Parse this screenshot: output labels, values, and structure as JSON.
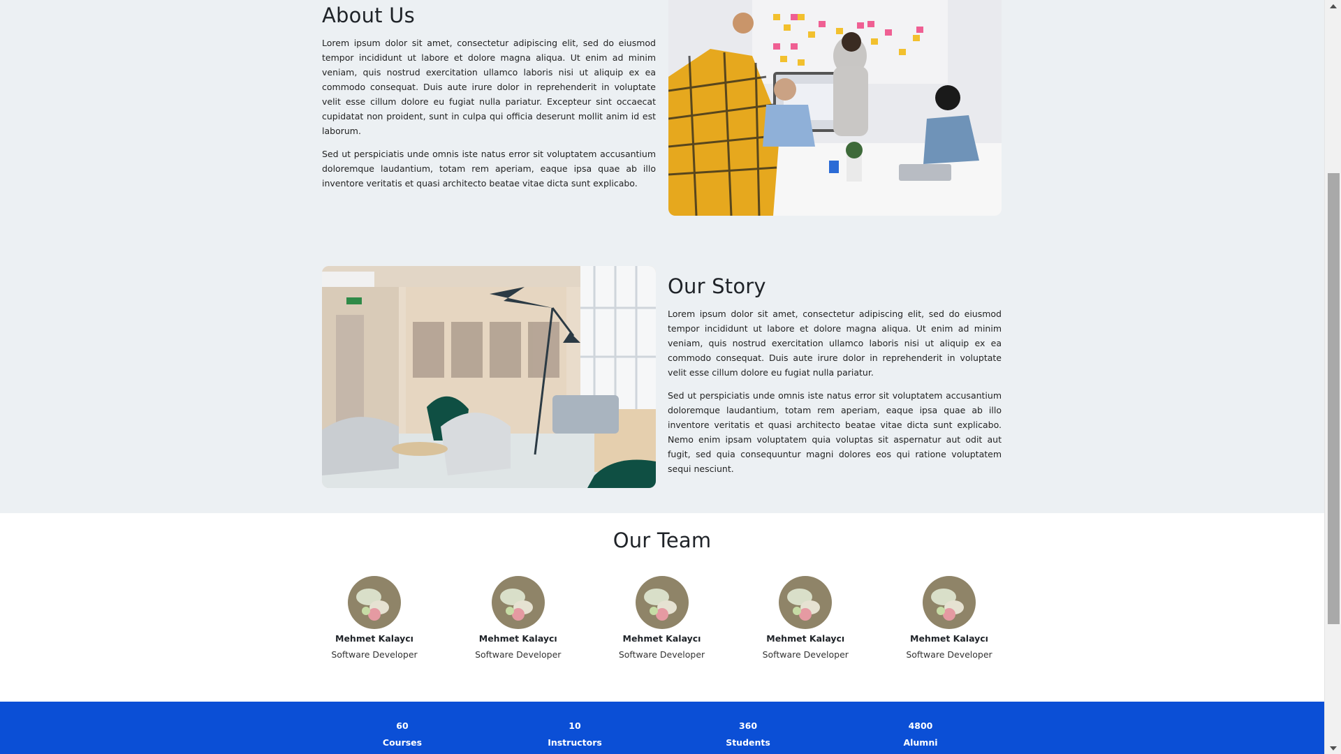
{
  "about": {
    "title": "About Us",
    "paragraphs": [
      "Lorem ipsum dolor sit amet, consectetur adipiscing elit, sed do eiusmod tempor incididunt ut labore et dolore magna aliqua. Ut enim ad minim veniam, quis nostrud exercitation ullamco laboris nisi ut aliquip ex ea commodo consequat. Duis aute irure dolor in reprehenderit in voluptate velit esse cillum dolore eu fugiat nulla pariatur. Excepteur sint occaecat cupidatat non proident, sunt in culpa qui officia deserunt mollit anim id est laborum.",
      "Sed ut perspiciatis unde omnis iste natus error sit voluptatem accusantium doloremque laudantium, totam rem aperiam, eaque ipsa quae ab illo inventore veritatis et quasi architecto beatae vitae dicta sunt explicabo."
    ]
  },
  "story": {
    "title": "Our Story",
    "paragraphs": [
      "Lorem ipsum dolor sit amet, consectetur adipiscing elit, sed do eiusmod tempor incididunt ut labore et dolore magna aliqua. Ut enim ad minim veniam, quis nostrud exercitation ullamco laboris nisi ut aliquip ex ea commodo consequat. Duis aute irure dolor in reprehenderit in voluptate velit esse cillum dolore eu fugiat nulla pariatur.",
      "Sed ut perspiciatis unde omnis iste natus error sit voluptatem accusantium doloremque laudantium, totam rem aperiam, eaque ipsa quae ab illo inventore veritatis et quasi architecto beatae vitae dicta sunt explicabo. Nemo enim ipsam voluptatem quia voluptas sit aspernatur aut odit aut fugit, sed quia consequuntur magni dolores eos qui ratione voluptatem sequi nesciunt."
    ]
  },
  "team": {
    "title": "Our Team",
    "members": [
      {
        "name": "Mehmet Kalaycı",
        "role": "Software Developer"
      },
      {
        "name": "Mehmet Kalaycı",
        "role": "Software Developer"
      },
      {
        "name": "Mehmet Kalaycı",
        "role": "Software Developer"
      },
      {
        "name": "Mehmet Kalaycı",
        "role": "Software Developer"
      },
      {
        "name": "Mehmet Kalaycı",
        "role": "Software Developer"
      }
    ]
  },
  "stats": [
    {
      "value": "60",
      "label": "Courses"
    },
    {
      "value": "10",
      "label": "Instructors"
    },
    {
      "value": "360",
      "label": "Students"
    },
    {
      "value": "4800",
      "label": "Alumni"
    }
  ],
  "colors": {
    "page_bg": "#ecf0f3",
    "team_bg": "#ffffff",
    "stats_bg": "#0b4fd6",
    "text": "#1f2328"
  }
}
